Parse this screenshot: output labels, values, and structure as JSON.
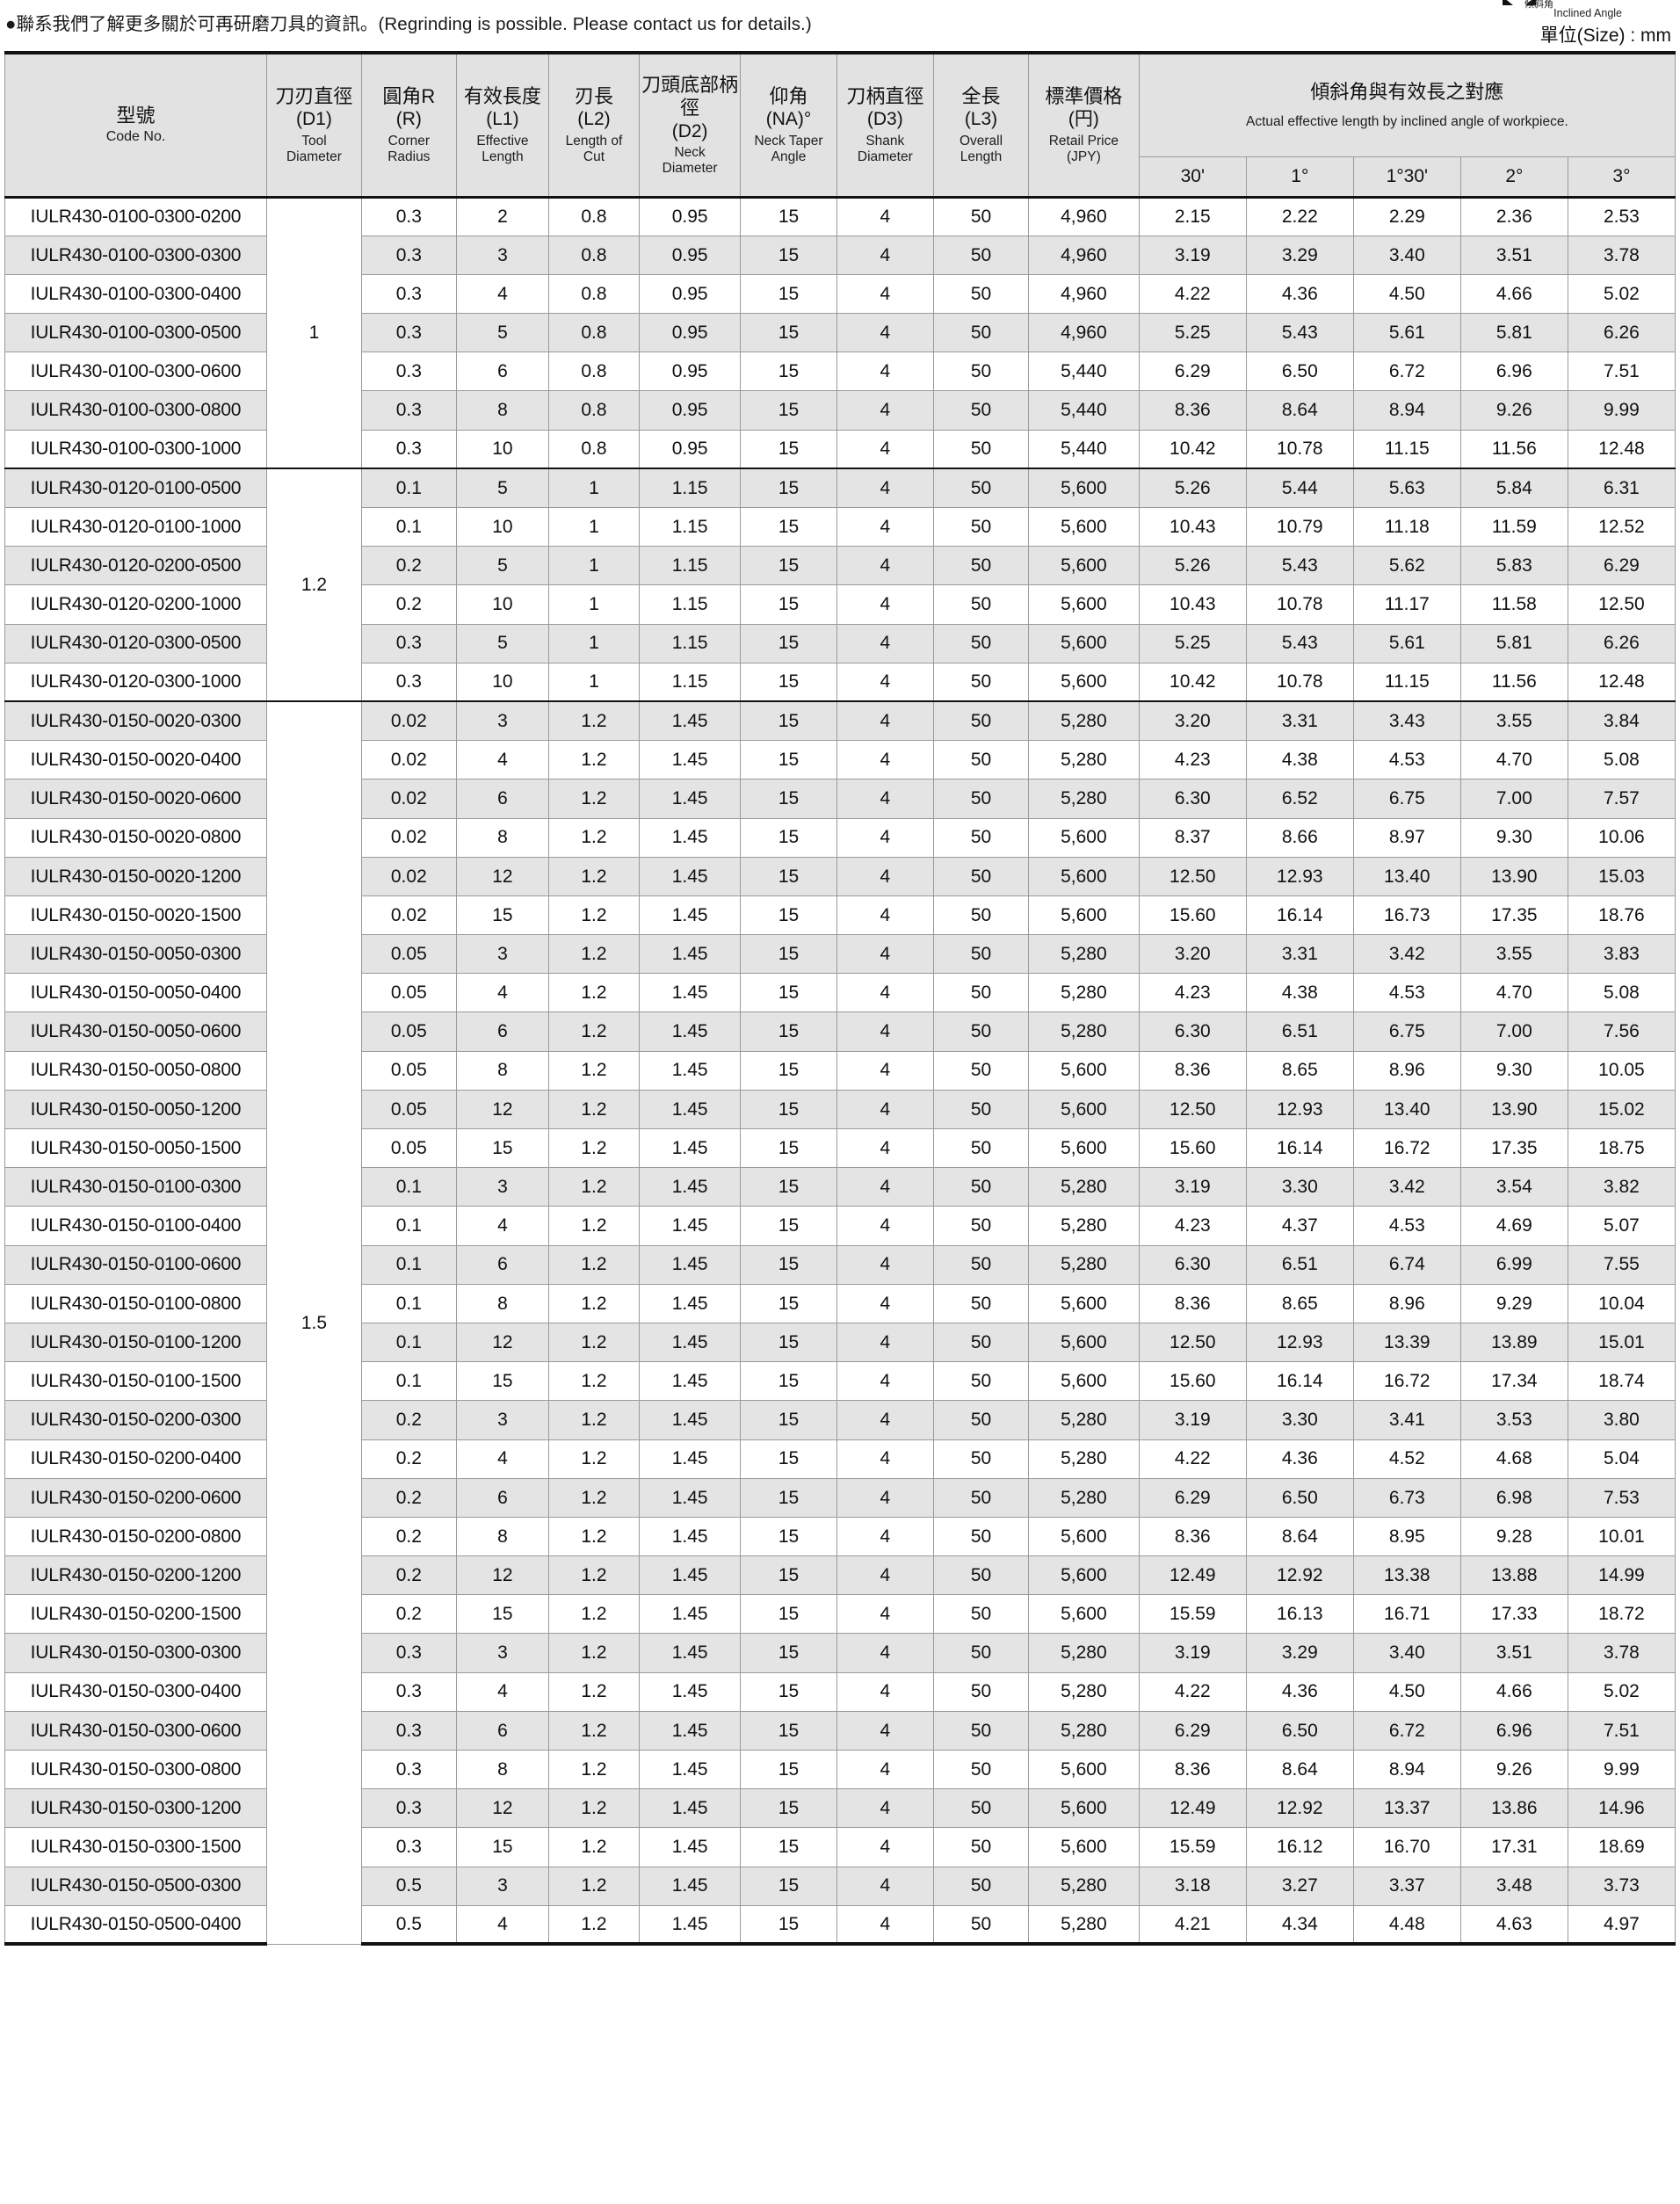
{
  "note": "●聯系我們了解更多關於可再研磨刀具的資訊。(Regrinding is possible. Please contact us for details.)",
  "corner": {
    "label_ja": "傾斜角",
    "label_en": "Inclined Angle",
    "icon": "inclined-angle-icon"
  },
  "units": "單位(Size) : mm",
  "header": {
    "model": {
      "zh": "型號",
      "en": "Code No."
    },
    "columns": [
      {
        "zh": "刀刃直徑",
        "code": "(D1)",
        "en1": "Tool",
        "en2": "Diameter"
      },
      {
        "zh": "圓角R",
        "code": "(R)",
        "en1": "Corner",
        "en2": "Radius"
      },
      {
        "zh": "有效長度",
        "code": "(L1)",
        "en1": "Effective",
        "en2": "Length"
      },
      {
        "zh": "刃長",
        "code": "(L2)",
        "en1": "Length of",
        "en2": "Cut"
      },
      {
        "zh": "刀頭底部柄徑",
        "code": "(D2)",
        "en1": "Neck",
        "en2": "Diameter"
      },
      {
        "zh": "仰角",
        "code": "(NA)°",
        "en1": "Neck Taper",
        "en2": "Angle"
      },
      {
        "zh": "刀柄直徑",
        "code": "(D3)",
        "en1": "Shank",
        "en2": "Diameter"
      },
      {
        "zh": "全長",
        "code": "(L3)",
        "en1": "Overall",
        "en2": "Length"
      },
      {
        "zh": "標準價格",
        "code": "(円)",
        "en1": "Retail Price",
        "en2": "(JPY)"
      }
    ],
    "angle_group": {
      "zh": "傾斜角與有效長之對應",
      "en": "Actual effective length by inclined angle of workpiece.",
      "sub": [
        "30'",
        "1°",
        "1°30'",
        "2°",
        "3°"
      ]
    }
  },
  "groups": [
    {
      "d1": "1",
      "rows": [
        {
          "code": "IULR430-0100-0300-0200",
          "r": "0.3",
          "l1": "2",
          "l2": "0.8",
          "d2": "0.95",
          "na": "15",
          "d3": "4",
          "l3": "50",
          "price": "4,960",
          "ang": [
            "2.15",
            "2.22",
            "2.29",
            "2.36",
            "2.53"
          ]
        },
        {
          "code": "IULR430-0100-0300-0300",
          "r": "0.3",
          "l1": "3",
          "l2": "0.8",
          "d2": "0.95",
          "na": "15",
          "d3": "4",
          "l3": "50",
          "price": "4,960",
          "ang": [
            "3.19",
            "3.29",
            "3.40",
            "3.51",
            "3.78"
          ]
        },
        {
          "code": "IULR430-0100-0300-0400",
          "r": "0.3",
          "l1": "4",
          "l2": "0.8",
          "d2": "0.95",
          "na": "15",
          "d3": "4",
          "l3": "50",
          "price": "4,960",
          "ang": [
            "4.22",
            "4.36",
            "4.50",
            "4.66",
            "5.02"
          ]
        },
        {
          "code": "IULR430-0100-0300-0500",
          "r": "0.3",
          "l1": "5",
          "l2": "0.8",
          "d2": "0.95",
          "na": "15",
          "d3": "4",
          "l3": "50",
          "price": "4,960",
          "ang": [
            "5.25",
            "5.43",
            "5.61",
            "5.81",
            "6.26"
          ]
        },
        {
          "code": "IULR430-0100-0300-0600",
          "r": "0.3",
          "l1": "6",
          "l2": "0.8",
          "d2": "0.95",
          "na": "15",
          "d3": "4",
          "l3": "50",
          "price": "5,440",
          "ang": [
            "6.29",
            "6.50",
            "6.72",
            "6.96",
            "7.51"
          ]
        },
        {
          "code": "IULR430-0100-0300-0800",
          "r": "0.3",
          "l1": "8",
          "l2": "0.8",
          "d2": "0.95",
          "na": "15",
          "d3": "4",
          "l3": "50",
          "price": "5,440",
          "ang": [
            "8.36",
            "8.64",
            "8.94",
            "9.26",
            "9.99"
          ]
        },
        {
          "code": "IULR430-0100-0300-1000",
          "r": "0.3",
          "l1": "10",
          "l2": "0.8",
          "d2": "0.95",
          "na": "15",
          "d3": "4",
          "l3": "50",
          "price": "5,440",
          "ang": [
            "10.42",
            "10.78",
            "11.15",
            "11.56",
            "12.48"
          ]
        }
      ]
    },
    {
      "d1": "1.2",
      "rows": [
        {
          "code": "IULR430-0120-0100-0500",
          "r": "0.1",
          "l1": "5",
          "l2": "1",
          "d2": "1.15",
          "na": "15",
          "d3": "4",
          "l3": "50",
          "price": "5,600",
          "ang": [
            "5.26",
            "5.44",
            "5.63",
            "5.84",
            "6.31"
          ]
        },
        {
          "code": "IULR430-0120-0100-1000",
          "r": "0.1",
          "l1": "10",
          "l2": "1",
          "d2": "1.15",
          "na": "15",
          "d3": "4",
          "l3": "50",
          "price": "5,600",
          "ang": [
            "10.43",
            "10.79",
            "11.18",
            "11.59",
            "12.52"
          ]
        },
        {
          "code": "IULR430-0120-0200-0500",
          "r": "0.2",
          "l1": "5",
          "l2": "1",
          "d2": "1.15",
          "na": "15",
          "d3": "4",
          "l3": "50",
          "price": "5,600",
          "ang": [
            "5.26",
            "5.43",
            "5.62",
            "5.83",
            "6.29"
          ]
        },
        {
          "code": "IULR430-0120-0200-1000",
          "r": "0.2",
          "l1": "10",
          "l2": "1",
          "d2": "1.15",
          "na": "15",
          "d3": "4",
          "l3": "50",
          "price": "5,600",
          "ang": [
            "10.43",
            "10.78",
            "11.17",
            "11.58",
            "12.50"
          ]
        },
        {
          "code": "IULR430-0120-0300-0500",
          "r": "0.3",
          "l1": "5",
          "l2": "1",
          "d2": "1.15",
          "na": "15",
          "d3": "4",
          "l3": "50",
          "price": "5,600",
          "ang": [
            "5.25",
            "5.43",
            "5.61",
            "5.81",
            "6.26"
          ]
        },
        {
          "code": "IULR430-0120-0300-1000",
          "r": "0.3",
          "l1": "10",
          "l2": "1",
          "d2": "1.15",
          "na": "15",
          "d3": "4",
          "l3": "50",
          "price": "5,600",
          "ang": [
            "10.42",
            "10.78",
            "11.15",
            "11.56",
            "12.48"
          ]
        }
      ]
    },
    {
      "d1": "1.5",
      "rows": [
        {
          "code": "IULR430-0150-0020-0300",
          "r": "0.02",
          "l1": "3",
          "l2": "1.2",
          "d2": "1.45",
          "na": "15",
          "d3": "4",
          "l3": "50",
          "price": "5,280",
          "ang": [
            "3.20",
            "3.31",
            "3.43",
            "3.55",
            "3.84"
          ]
        },
        {
          "code": "IULR430-0150-0020-0400",
          "r": "0.02",
          "l1": "4",
          "l2": "1.2",
          "d2": "1.45",
          "na": "15",
          "d3": "4",
          "l3": "50",
          "price": "5,280",
          "ang": [
            "4.23",
            "4.38",
            "4.53",
            "4.70",
            "5.08"
          ]
        },
        {
          "code": "IULR430-0150-0020-0600",
          "r": "0.02",
          "l1": "6",
          "l2": "1.2",
          "d2": "1.45",
          "na": "15",
          "d3": "4",
          "l3": "50",
          "price": "5,280",
          "ang": [
            "6.30",
            "6.52",
            "6.75",
            "7.00",
            "7.57"
          ]
        },
        {
          "code": "IULR430-0150-0020-0800",
          "r": "0.02",
          "l1": "8",
          "l2": "1.2",
          "d2": "1.45",
          "na": "15",
          "d3": "4",
          "l3": "50",
          "price": "5,600",
          "ang": [
            "8.37",
            "8.66",
            "8.97",
            "9.30",
            "10.06"
          ]
        },
        {
          "code": "IULR430-0150-0020-1200",
          "r": "0.02",
          "l1": "12",
          "l2": "1.2",
          "d2": "1.45",
          "na": "15",
          "d3": "4",
          "l3": "50",
          "price": "5,600",
          "ang": [
            "12.50",
            "12.93",
            "13.40",
            "13.90",
            "15.03"
          ]
        },
        {
          "code": "IULR430-0150-0020-1500",
          "r": "0.02",
          "l1": "15",
          "l2": "1.2",
          "d2": "1.45",
          "na": "15",
          "d3": "4",
          "l3": "50",
          "price": "5,600",
          "ang": [
            "15.60",
            "16.14",
            "16.73",
            "17.35",
            "18.76"
          ]
        },
        {
          "code": "IULR430-0150-0050-0300",
          "r": "0.05",
          "l1": "3",
          "l2": "1.2",
          "d2": "1.45",
          "na": "15",
          "d3": "4",
          "l3": "50",
          "price": "5,280",
          "ang": [
            "3.20",
            "3.31",
            "3.42",
            "3.55",
            "3.83"
          ]
        },
        {
          "code": "IULR430-0150-0050-0400",
          "r": "0.05",
          "l1": "4",
          "l2": "1.2",
          "d2": "1.45",
          "na": "15",
          "d3": "4",
          "l3": "50",
          "price": "5,280",
          "ang": [
            "4.23",
            "4.38",
            "4.53",
            "4.70",
            "5.08"
          ]
        },
        {
          "code": "IULR430-0150-0050-0600",
          "r": "0.05",
          "l1": "6",
          "l2": "1.2",
          "d2": "1.45",
          "na": "15",
          "d3": "4",
          "l3": "50",
          "price": "5,280",
          "ang": [
            "6.30",
            "6.51",
            "6.75",
            "7.00",
            "7.56"
          ]
        },
        {
          "code": "IULR430-0150-0050-0800",
          "r": "0.05",
          "l1": "8",
          "l2": "1.2",
          "d2": "1.45",
          "na": "15",
          "d3": "4",
          "l3": "50",
          "price": "5,600",
          "ang": [
            "8.36",
            "8.65",
            "8.96",
            "9.30",
            "10.05"
          ]
        },
        {
          "code": "IULR430-0150-0050-1200",
          "r": "0.05",
          "l1": "12",
          "l2": "1.2",
          "d2": "1.45",
          "na": "15",
          "d3": "4",
          "l3": "50",
          "price": "5,600",
          "ang": [
            "12.50",
            "12.93",
            "13.40",
            "13.90",
            "15.02"
          ]
        },
        {
          "code": "IULR430-0150-0050-1500",
          "r": "0.05",
          "l1": "15",
          "l2": "1.2",
          "d2": "1.45",
          "na": "15",
          "d3": "4",
          "l3": "50",
          "price": "5,600",
          "ang": [
            "15.60",
            "16.14",
            "16.72",
            "17.35",
            "18.75"
          ]
        },
        {
          "code": "IULR430-0150-0100-0300",
          "r": "0.1",
          "l1": "3",
          "l2": "1.2",
          "d2": "1.45",
          "na": "15",
          "d3": "4",
          "l3": "50",
          "price": "5,280",
          "ang": [
            "3.19",
            "3.30",
            "3.42",
            "3.54",
            "3.82"
          ]
        },
        {
          "code": "IULR430-0150-0100-0400",
          "r": "0.1",
          "l1": "4",
          "l2": "1.2",
          "d2": "1.45",
          "na": "15",
          "d3": "4",
          "l3": "50",
          "price": "5,280",
          "ang": [
            "4.23",
            "4.37",
            "4.53",
            "4.69",
            "5.07"
          ]
        },
        {
          "code": "IULR430-0150-0100-0600",
          "r": "0.1",
          "l1": "6",
          "l2": "1.2",
          "d2": "1.45",
          "na": "15",
          "d3": "4",
          "l3": "50",
          "price": "5,280",
          "ang": [
            "6.30",
            "6.51",
            "6.74",
            "6.99",
            "7.55"
          ]
        },
        {
          "code": "IULR430-0150-0100-0800",
          "r": "0.1",
          "l1": "8",
          "l2": "1.2",
          "d2": "1.45",
          "na": "15",
          "d3": "4",
          "l3": "50",
          "price": "5,600",
          "ang": [
            "8.36",
            "8.65",
            "8.96",
            "9.29",
            "10.04"
          ]
        },
        {
          "code": "IULR430-0150-0100-1200",
          "r": "0.1",
          "l1": "12",
          "l2": "1.2",
          "d2": "1.45",
          "na": "15",
          "d3": "4",
          "l3": "50",
          "price": "5,600",
          "ang": [
            "12.50",
            "12.93",
            "13.39",
            "13.89",
            "15.01"
          ]
        },
        {
          "code": "IULR430-0150-0100-1500",
          "r": "0.1",
          "l1": "15",
          "l2": "1.2",
          "d2": "1.45",
          "na": "15",
          "d3": "4",
          "l3": "50",
          "price": "5,600",
          "ang": [
            "15.60",
            "16.14",
            "16.72",
            "17.34",
            "18.74"
          ]
        },
        {
          "code": "IULR430-0150-0200-0300",
          "r": "0.2",
          "l1": "3",
          "l2": "1.2",
          "d2": "1.45",
          "na": "15",
          "d3": "4",
          "l3": "50",
          "price": "5,280",
          "ang": [
            "3.19",
            "3.30",
            "3.41",
            "3.53",
            "3.80"
          ]
        },
        {
          "code": "IULR430-0150-0200-0400",
          "r": "0.2",
          "l1": "4",
          "l2": "1.2",
          "d2": "1.45",
          "na": "15",
          "d3": "4",
          "l3": "50",
          "price": "5,280",
          "ang": [
            "4.22",
            "4.36",
            "4.52",
            "4.68",
            "5.04"
          ]
        },
        {
          "code": "IULR430-0150-0200-0600",
          "r": "0.2",
          "l1": "6",
          "l2": "1.2",
          "d2": "1.45",
          "na": "15",
          "d3": "4",
          "l3": "50",
          "price": "5,280",
          "ang": [
            "6.29",
            "6.50",
            "6.73",
            "6.98",
            "7.53"
          ]
        },
        {
          "code": "IULR430-0150-0200-0800",
          "r": "0.2",
          "l1": "8",
          "l2": "1.2",
          "d2": "1.45",
          "na": "15",
          "d3": "4",
          "l3": "50",
          "price": "5,600",
          "ang": [
            "8.36",
            "8.64",
            "8.95",
            "9.28",
            "10.01"
          ]
        },
        {
          "code": "IULR430-0150-0200-1200",
          "r": "0.2",
          "l1": "12",
          "l2": "1.2",
          "d2": "1.45",
          "na": "15",
          "d3": "4",
          "l3": "50",
          "price": "5,600",
          "ang": [
            "12.49",
            "12.92",
            "13.38",
            "13.88",
            "14.99"
          ]
        },
        {
          "code": "IULR430-0150-0200-1500",
          "r": "0.2",
          "l1": "15",
          "l2": "1.2",
          "d2": "1.45",
          "na": "15",
          "d3": "4",
          "l3": "50",
          "price": "5,600",
          "ang": [
            "15.59",
            "16.13",
            "16.71",
            "17.33",
            "18.72"
          ]
        },
        {
          "code": "IULR430-0150-0300-0300",
          "r": "0.3",
          "l1": "3",
          "l2": "1.2",
          "d2": "1.45",
          "na": "15",
          "d3": "4",
          "l3": "50",
          "price": "5,280",
          "ang": [
            "3.19",
            "3.29",
            "3.40",
            "3.51",
            "3.78"
          ]
        },
        {
          "code": "IULR430-0150-0300-0400",
          "r": "0.3",
          "l1": "4",
          "l2": "1.2",
          "d2": "1.45",
          "na": "15",
          "d3": "4",
          "l3": "50",
          "price": "5,280",
          "ang": [
            "4.22",
            "4.36",
            "4.50",
            "4.66",
            "5.02"
          ]
        },
        {
          "code": "IULR430-0150-0300-0600",
          "r": "0.3",
          "l1": "6",
          "l2": "1.2",
          "d2": "1.45",
          "na": "15",
          "d3": "4",
          "l3": "50",
          "price": "5,280",
          "ang": [
            "6.29",
            "6.50",
            "6.72",
            "6.96",
            "7.51"
          ]
        },
        {
          "code": "IULR430-0150-0300-0800",
          "r": "0.3",
          "l1": "8",
          "l2": "1.2",
          "d2": "1.45",
          "na": "15",
          "d3": "4",
          "l3": "50",
          "price": "5,600",
          "ang": [
            "8.36",
            "8.64",
            "8.94",
            "9.26",
            "9.99"
          ]
        },
        {
          "code": "IULR430-0150-0300-1200",
          "r": "0.3",
          "l1": "12",
          "l2": "1.2",
          "d2": "1.45",
          "na": "15",
          "d3": "4",
          "l3": "50",
          "price": "5,600",
          "ang": [
            "12.49",
            "12.92",
            "13.37",
            "13.86",
            "14.96"
          ]
        },
        {
          "code": "IULR430-0150-0300-1500",
          "r": "0.3",
          "l1": "15",
          "l2": "1.2",
          "d2": "1.45",
          "na": "15",
          "d3": "4",
          "l3": "50",
          "price": "5,600",
          "ang": [
            "15.59",
            "16.12",
            "16.70",
            "17.31",
            "18.69"
          ]
        },
        {
          "code": "IULR430-0150-0500-0300",
          "r": "0.5",
          "l1": "3",
          "l2": "1.2",
          "d2": "1.45",
          "na": "15",
          "d3": "4",
          "l3": "50",
          "price": "5,280",
          "ang": [
            "3.18",
            "3.27",
            "3.37",
            "3.48",
            "3.73"
          ]
        },
        {
          "code": "IULR430-0150-0500-0400",
          "r": "0.5",
          "l1": "4",
          "l2": "1.2",
          "d2": "1.45",
          "na": "15",
          "d3": "4",
          "l3": "50",
          "price": "5,280",
          "ang": [
            "4.21",
            "4.34",
            "4.48",
            "4.63",
            "4.97"
          ]
        }
      ]
    }
  ]
}
